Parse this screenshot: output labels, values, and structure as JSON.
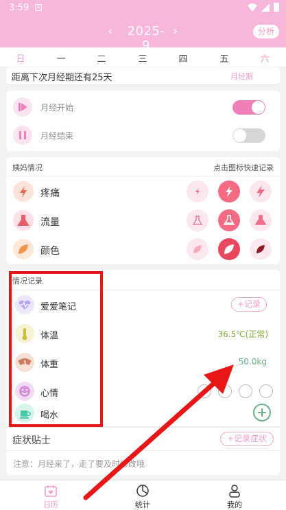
{
  "status_bar": {
    "time": "3:59",
    "notif_letter": "A"
  },
  "header": {
    "prev": "‹",
    "next": "›",
    "month": "2025-9",
    "analyze_label": "分析"
  },
  "weekdays": [
    "日",
    "一",
    "二",
    "三",
    "四",
    "五",
    "六"
  ],
  "countdown": {
    "text": "距离下次月经期还有25天",
    "tag": "月经期"
  },
  "period": {
    "start_label": "月经开始",
    "end_label": "月经结束",
    "start_on": true,
    "end_on": false
  },
  "aunt_section": {
    "title": "姨妈情况",
    "hint": "点击图标快速记录",
    "rows": [
      {
        "label": "疼痛",
        "icon": "lightning-icon"
      },
      {
        "label": "流量",
        "icon": "flask-icon"
      },
      {
        "label": "颜色",
        "icon": "leaf-icon"
      }
    ]
  },
  "log_section": {
    "title": "情况记录",
    "rows": [
      {
        "label": "爱爱笔记",
        "icon": "heart-pulse-icon",
        "action": "+记录"
      },
      {
        "label": "体温",
        "icon": "thermometer-icon",
        "value": "36.5℃(正常)"
      },
      {
        "label": "体重",
        "icon": "scale-icon",
        "value": "50.0kg"
      },
      {
        "label": "心情",
        "icon": "smile-icon"
      },
      {
        "label": "喝水",
        "icon": "cup-icon"
      }
    ]
  },
  "symptoms": {
    "title": "症状贴士",
    "button": "+记录症状"
  },
  "note": {
    "text": "注意：月经来了，走了要及时修改哦"
  },
  "bottom_nav": [
    {
      "label": "日历",
      "icon": "calendar-heart-icon",
      "active": true
    },
    {
      "label": "统计",
      "icon": "pie-chart-icon",
      "active": false
    },
    {
      "label": "我的",
      "icon": "user-icon",
      "active": false
    }
  ],
  "colors": {
    "header": "#f6b7db",
    "accent": "#f19ac9",
    "switch_on": "#f07fb9"
  }
}
